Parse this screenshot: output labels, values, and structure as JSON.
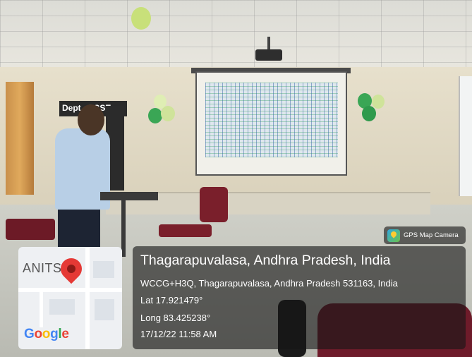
{
  "photo": {
    "sign_text": "Dept of CSE"
  },
  "gps_overlay": {
    "app_badge": "GPS Map Camera",
    "app_icon": "gps-map-camera-icon",
    "map_label": "ANITS",
    "map_brand": "Google",
    "place_title": "Thagarapuvalasa, Andhra Pradesh, India",
    "address": "WCCG+H3Q, Thagarapuvalasa, Andhra Pradesh 531163, India",
    "latitude": "Lat 17.921479°",
    "longitude": "Long 83.425238°",
    "datetime": "17/12/22 11:58 AM"
  },
  "colors": {
    "overlay_bg": "#161616",
    "pin": "#e53935",
    "balloon_green": "#3aa655"
  }
}
